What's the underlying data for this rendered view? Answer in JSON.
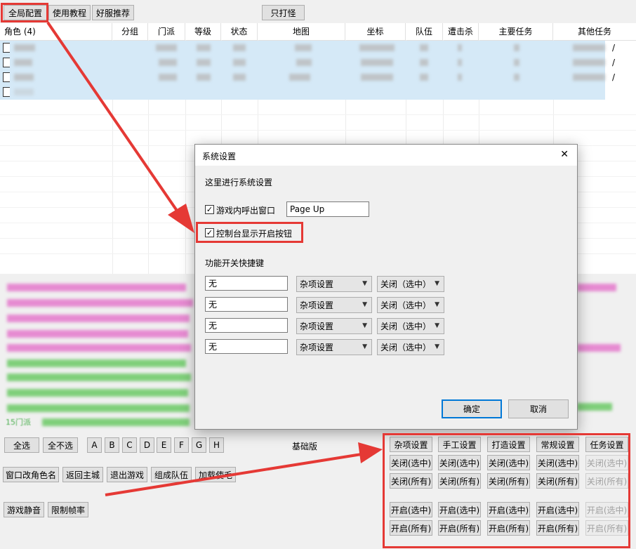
{
  "toolbar": {
    "global_config": "全局配置",
    "tutorial": "使用教程",
    "server_recommend": "好服推荐",
    "only_fight": "只打怪"
  },
  "grid": {
    "columns": [
      "角色 (4)",
      "分组",
      "门派",
      "等级",
      "状态",
      "地图",
      "坐标",
      "队伍",
      "遭击杀",
      "主要任务",
      "其他任务"
    ],
    "row_suffix": [
      "/",
      "/",
      "/",
      ""
    ]
  },
  "log": {
    "last_line_prefix": "15门派"
  },
  "bottom": {
    "select_all": "全选",
    "select_none": "全不选",
    "letters": [
      "A",
      "B",
      "C",
      "D",
      "E",
      "F",
      "G",
      "H"
    ],
    "edition": "基础版",
    "rename": "窗口改角色名",
    "return_city": "返回主城",
    "exit_game": "退出游戏",
    "form_team": "组成队伍",
    "load_partial": "加载使毛",
    "mute": "游戏静音",
    "limit_fps": "限制帧率"
  },
  "settings_panel": {
    "tabs": [
      "杂项设置",
      "手工设置",
      "打造设置",
      "常规设置",
      "任务设置"
    ],
    "close_selected": "关闭(选中)",
    "close_all": "关闭(所有)",
    "open_selected": "开启(选中)",
    "open_all": "开启(所有)"
  },
  "dialog": {
    "title": "系统设置",
    "close_glyph": "✕",
    "intro": "这里进行系统设置",
    "hotkey_checkbox": "游戏内呼出窗口",
    "hotkey_value": "Page Up",
    "console_checkbox": "控制台显示开启按钮",
    "shortcut_header": "功能开关快捷键",
    "shortcuts": [
      {
        "key": "无",
        "category": "杂项设置",
        "action": "关闭（选中）"
      },
      {
        "key": "无",
        "category": "杂项设置",
        "action": "关闭（选中）"
      },
      {
        "key": "无",
        "category": "杂项设置",
        "action": "关闭（选中）"
      },
      {
        "key": "无",
        "category": "杂项设置",
        "action": "关闭（选中）"
      }
    ],
    "ok": "确定",
    "cancel": "取消"
  },
  "annotation_color": "#e53935"
}
